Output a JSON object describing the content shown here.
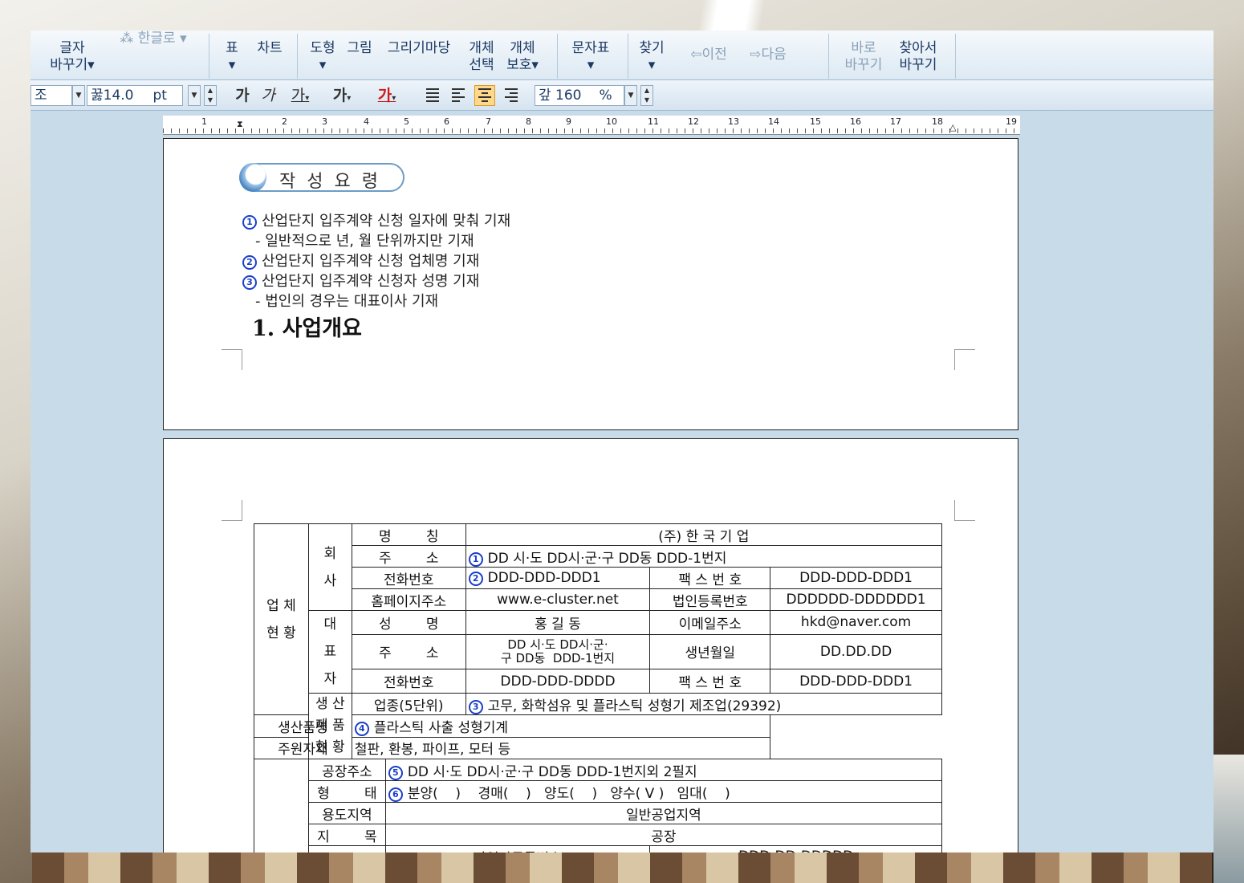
{
  "ribbon": {
    "char_change": "글자\n바꾸기▾",
    "hangul_to": "⁂ 한글로 ▾",
    "table": "표\n▾",
    "chart": "차트",
    "shape": "도형\n▾",
    "picture": "그림",
    "gallery": "그리기마당",
    "obj_select": "개체\n선택",
    "obj_protect": "개체\n보호▾",
    "char_map": "문자표\n▾",
    "find": "찾기\n▾",
    "prev": "이전",
    "next": "다음",
    "replace_now": "바로\n바꾸기",
    "find_replace": "찾아서\n바꾸기"
  },
  "format_bar": {
    "font": "조",
    "size_prefix": "꿇",
    "size": "14.0",
    "size_unit": "pt",
    "bold": "가",
    "italic": "가",
    "underline": "가",
    "strike": "가",
    "color": "가",
    "line_spacing_prefix": "갚",
    "line_spacing": "160",
    "line_spacing_unit": "%",
    "accent": "#d01a1a"
  },
  "ruler": {
    "ticks": [
      "1",
      "1",
      "2",
      "3",
      "4",
      "5",
      "6",
      "7",
      "8",
      "9",
      "10",
      "11",
      "12",
      "13",
      "14",
      "15",
      "16",
      "17",
      "18",
      "19"
    ]
  },
  "page1": {
    "badge": "작성요령",
    "items": [
      {
        "num": "1",
        "text": "산업단지 입주계약 신청 일자에 맞춰 기재"
      },
      {
        "num": "",
        "text": "- 일반적으로 년, 월 단위까지만 기재"
      },
      {
        "num": "2",
        "text": "산업단지 입주계약 신청 업체명 기재"
      },
      {
        "num": "3",
        "text": "산업단지 입주계약 신청자 성명 기재"
      },
      {
        "num": "",
        "text": "- 법인의 경우는 대표이사 기재"
      }
    ],
    "heading": "1.  사업개요"
  },
  "form": {
    "group_company": "업 체\n현 황",
    "sub_company": "회\n사",
    "sub_rep": "대\n표\n자",
    "name_label": "명        칭",
    "name_value": "(주) 한 국 기 업",
    "addr_label": "주        소",
    "addr_num": "1",
    "addr_value": "DD 시·도 DD시·군·구 DD동  DDD-1번지",
    "tel_label": "전화번호",
    "tel_num": "2",
    "tel_value": "DDD-DDD-DDD1",
    "fax_label": "팩 스 번 호",
    "fax_value": "DDD-DDD-DDD1",
    "homepage_label": "홈페이지주소",
    "homepage_value": "www.e-cluster.net",
    "corp_no_label": "법인등록번호",
    "corp_no_value": "DDDDDD-DDDDDD1",
    "rep_name_label": "성        명",
    "rep_name_value": "홍 길 동",
    "email_label": "이메일주소",
    "email_value": "hkd@naver.com",
    "rep_addr_label": "주        소",
    "rep_addr_value": "DD 시·도 DD시·군·\n구 DD동  DDD-1번지",
    "birth_label": "생년월일",
    "birth_value": "DD.DD.DD",
    "rep_tel_label": "전화번호",
    "rep_tel_value": "DDD-DDD-DDDD",
    "rep_fax_label": "팩 스 번 호",
    "rep_fax_value": "DDD-DDD-DDD1",
    "group_product": "생 산\n제 품\n현 황",
    "industry_label": "업종(5단위)",
    "industry_num": "3",
    "industry_value": "고무, 화학섬유 및 플라스틱 성형기 제조업(29392)",
    "product_label": "생산품명",
    "product_num": "4",
    "product_value": "플라스틱 사출 성형기계",
    "material_label": "주원자재",
    "material_value": "철판, 환봉, 파이프, 모터 등",
    "factory_label": "공장주소",
    "factory_num": "5",
    "factory_value": "DD 시·도 DD시·군·구 DD동  DDD-1번지외 2필지",
    "type_label": "형        태",
    "type_num": "6",
    "type_value": "분양(    )    경매(    )   양도(    )   양수( V )   임대(    )",
    "zone_label": "용도지역",
    "zone_value": "일반공업지역",
    "land_label": "지        목",
    "land_value": "공장",
    "bizreg_label": "사업자등록번호",
    "bizreg_value": "DDD-DD-DDDDD"
  }
}
